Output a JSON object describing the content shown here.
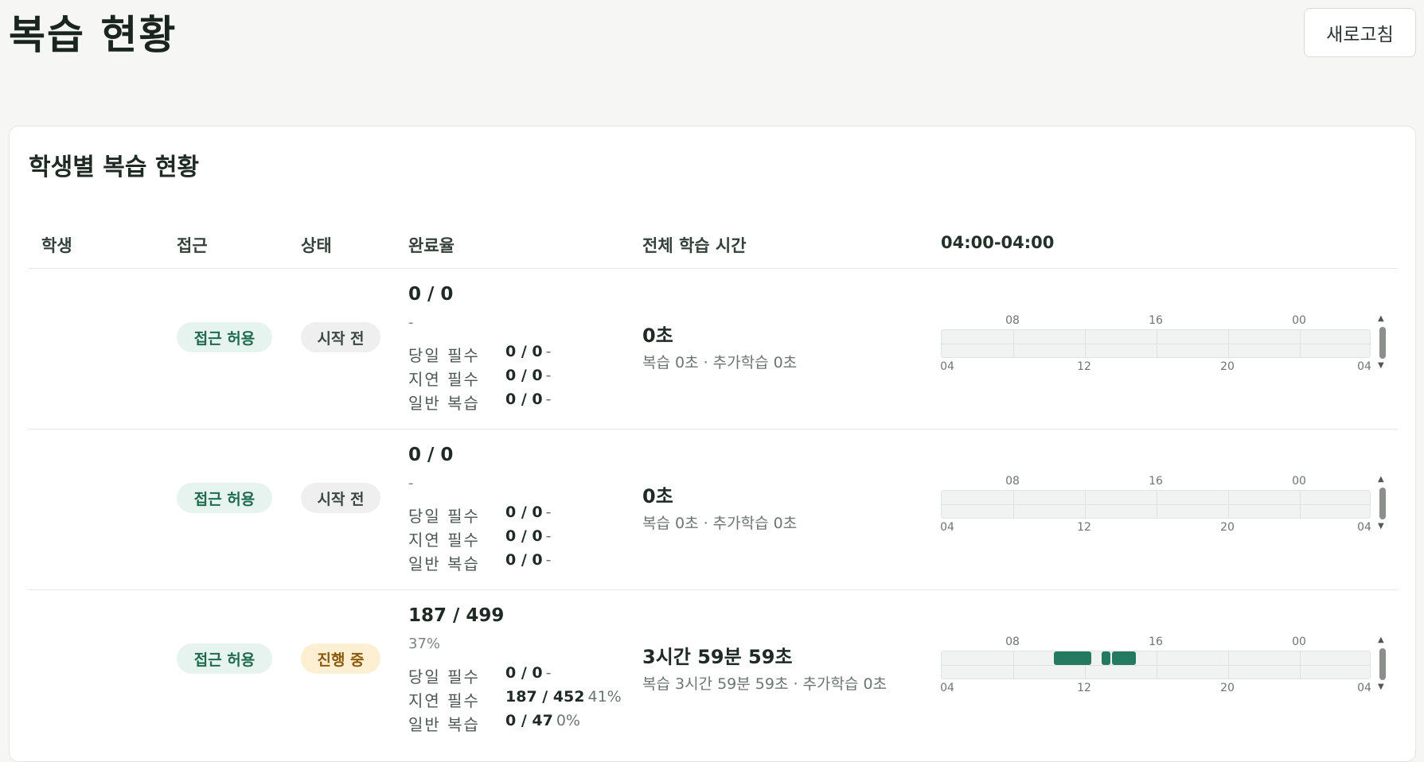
{
  "page_title": "복습 현황",
  "refresh_label": "새로고침",
  "card": {
    "title": "학생별 복습 현황",
    "headers": {
      "student": "학생",
      "access": "접근",
      "status": "상태",
      "completion": "완료율",
      "total_time": "전체 학습 시간",
      "range": "04:00-04:00"
    }
  },
  "timeline_labels": {
    "top": [
      "08",
      "16",
      "00"
    ],
    "bottom": [
      "04",
      "12",
      "20",
      "04"
    ]
  },
  "colors": {
    "accent": "#237a5e",
    "badge_access_bg": "#e6f3ee",
    "badge_active_bg": "#fdf0d2"
  },
  "rows": [
    {
      "student": "",
      "access": "접근 허용",
      "status": "시작 전",
      "status_kind": "idle",
      "ratio": "0 / 0",
      "pct": "-",
      "subs": [
        {
          "label": "당일 필수",
          "value": "0 / 0",
          "rate": "-"
        },
        {
          "label": "지연 필수",
          "value": "0 / 0",
          "rate": "-"
        },
        {
          "label": "일반 복습",
          "value": "0 / 0",
          "rate": "-"
        }
      ],
      "total": "0초",
      "total_detail": "복습 0초 · 추가학습 0초",
      "segments": []
    },
    {
      "student": "",
      "access": "접근 허용",
      "status": "시작 전",
      "status_kind": "idle",
      "ratio": "0 / 0",
      "pct": "-",
      "subs": [
        {
          "label": "당일 필수",
          "value": "0 / 0",
          "rate": "-"
        },
        {
          "label": "지연 필수",
          "value": "0 / 0",
          "rate": "-"
        },
        {
          "label": "일반 복습",
          "value": "0 / 0",
          "rate": "-"
        }
      ],
      "total": "0초",
      "total_detail": "복습 0초 · 추가학습 0초",
      "segments": []
    },
    {
      "student": "",
      "access": "접근 허용",
      "status": "진행 중",
      "status_kind": "active",
      "ratio": "187 / 499",
      "pct": "37%",
      "subs": [
        {
          "label": "당일 필수",
          "value": "0 / 0",
          "rate": "-"
        },
        {
          "label": "지연 필수",
          "value": "187 / 452",
          "rate": "41%"
        },
        {
          "label": "일반 복습",
          "value": "0 / 47",
          "rate": "0%"
        }
      ],
      "total": "3시간 59분 59초",
      "total_detail": "복습 3시간 59분 59초 · 추가학습 0초",
      "segments": [
        {
          "start": "10:15",
          "end": "12:20"
        },
        {
          "start": "12:55",
          "end": "13:25"
        },
        {
          "start": "13:30",
          "end": "14:50"
        }
      ]
    }
  ]
}
